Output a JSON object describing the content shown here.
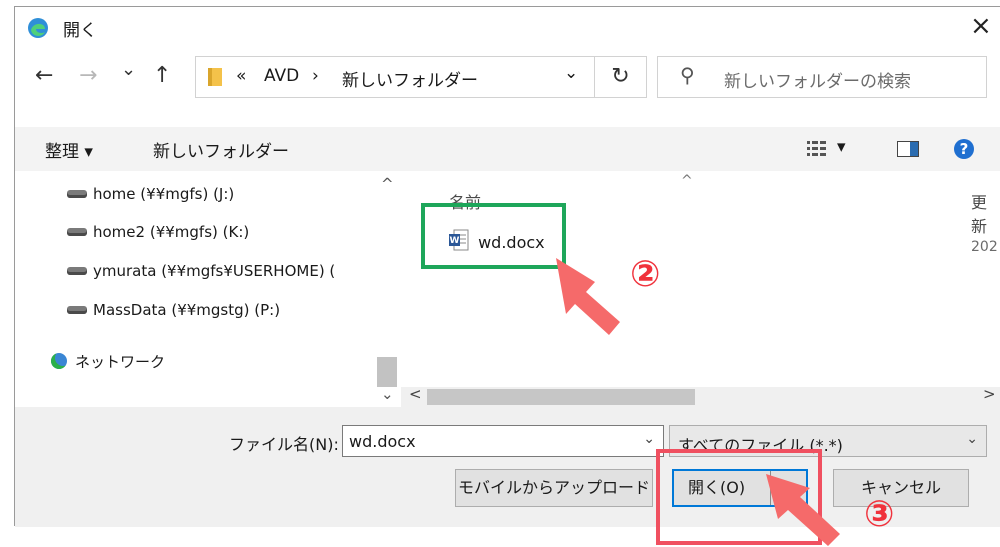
{
  "window": {
    "title": "開く",
    "close_label": "×"
  },
  "nav": {
    "back": "←",
    "forward": "→",
    "history": "⌄",
    "up": "↑"
  },
  "address": {
    "overflow": "«",
    "crumbs": [
      "AVD",
      "新しいフォルダー"
    ],
    "separator": "›",
    "dropdown": "⌄",
    "refresh": "↻"
  },
  "search": {
    "icon": "⚲",
    "placeholder": "新しいフォルダーの検索"
  },
  "toolbar": {
    "organize": "整理 ▾",
    "new_folder": "新しいフォルダー",
    "view_menu_arrow": "▾",
    "help": "?"
  },
  "tree": {
    "items": [
      {
        "label": "home (¥¥mgfs) (J:)",
        "icon": "network-drive-icon"
      },
      {
        "label": "home2 (¥¥mgfs) (K:)",
        "icon": "network-drive-icon"
      },
      {
        "label": "ymurata (¥¥mgfs¥USERHOME) (",
        "icon": "network-drive-icon"
      },
      {
        "label": "MassData (¥¥mgstg) (P:)",
        "icon": "network-drive-icon"
      },
      {
        "label": "ネットワーク",
        "icon": "network-icon"
      }
    ],
    "scroll_up": "^",
    "scroll_down": "⌄"
  },
  "files": {
    "columns": {
      "name": "名前",
      "modified": "更新"
    },
    "sort_indicator": "^",
    "items": [
      {
        "name": "wd.docx",
        "modified": "202"
      }
    ],
    "scroll_left": "<",
    "scroll_right": ">"
  },
  "bottom": {
    "filename_label": "ファイル名(N):",
    "filename_value": "wd.docx",
    "filetype_value": "すべてのファイル (*.*)",
    "dropdown": "⌄",
    "upload_button": "モバイルからアップロード",
    "open_button": "開く(O)",
    "open_split": "▾",
    "cancel_button": "キャンセル"
  },
  "annotations": {
    "step2": "②",
    "step3": "③"
  },
  "colors": {
    "accent": "#0078d7",
    "green_mark": "#1ea65a",
    "red_mark": "#f05060",
    "arrow": "#f56a6a",
    "step_number": "#f0323c"
  }
}
